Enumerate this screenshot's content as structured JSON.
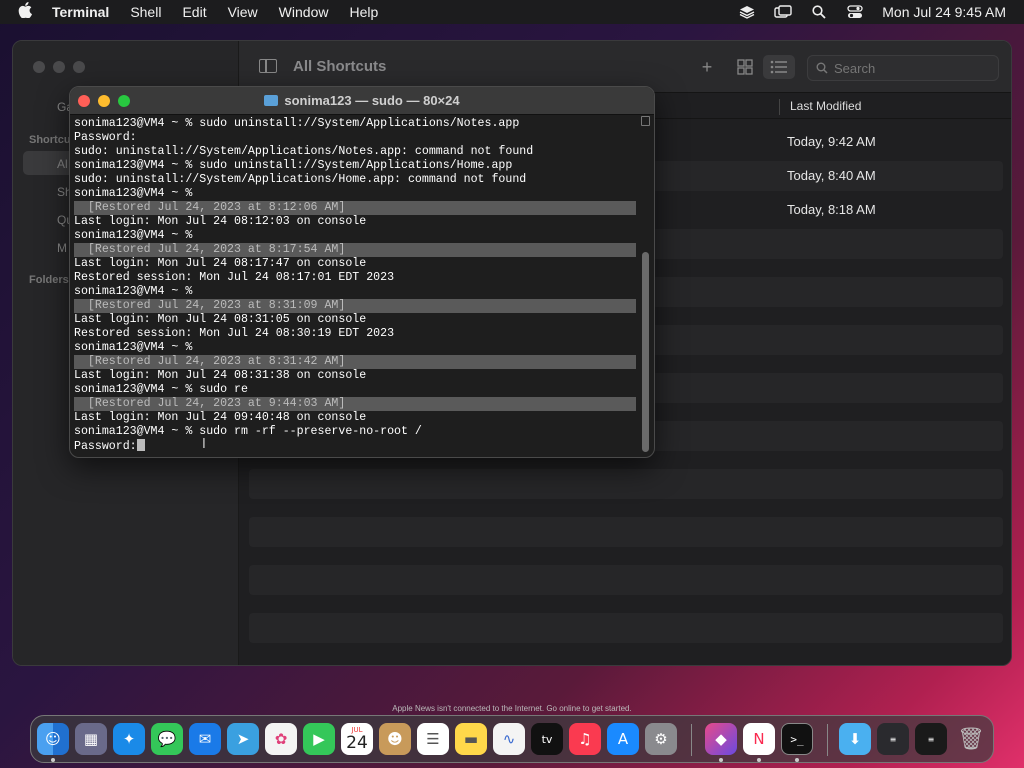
{
  "menubar": {
    "app": "Terminal",
    "items": [
      "Shell",
      "Edit",
      "View",
      "Window",
      "Help"
    ],
    "clock": "Mon Jul 24  9:45 AM"
  },
  "shortcuts": {
    "title": "All Shortcuts",
    "search_placeholder": "Search",
    "column_header": "Last Modified",
    "sidebar_partial": [
      "Ga",
      "Shortcu",
      "Al",
      "Sh",
      "Qu",
      "M",
      "Folders"
    ],
    "rows": [
      {
        "date": "Today, 9:42 AM"
      },
      {
        "date": "Today, 8:40 AM"
      },
      {
        "date": "Today, 8:18 AM"
      }
    ]
  },
  "terminal": {
    "title": "sonima123 — sudo — 80×24",
    "lines": [
      {
        "text": "sonima123@VM4 ~ % sudo uninstall://System/Applications/Notes.app",
        "type": "prompt"
      },
      {
        "text": "Password:",
        "type": "normal"
      },
      {
        "text": "sudo: uninstall://System/Applications/Notes.app: command not found",
        "type": "normal"
      },
      {
        "text": "sonima123@VM4 ~ % sudo uninstall://System/Applications/Home.app",
        "type": "prompt"
      },
      {
        "text": "sudo: uninstall://System/Applications/Home.app: command not found",
        "type": "normal"
      },
      {
        "text": "sonima123@VM4 ~ %",
        "type": "normal"
      },
      {
        "text": "  [Restored Jul 24, 2023 at 8:12:06 AM]",
        "type": "restored"
      },
      {
        "text": "Last login: Mon Jul 24 08:12:03 on console",
        "type": "normal"
      },
      {
        "text": "sonima123@VM4 ~ %",
        "type": "normal"
      },
      {
        "text": "  [Restored Jul 24, 2023 at 8:17:54 AM]",
        "type": "restored"
      },
      {
        "text": "Last login: Mon Jul 24 08:17:47 on console",
        "type": "normal"
      },
      {
        "text": "Restored session: Mon Jul 24 08:17:01 EDT 2023",
        "type": "normal"
      },
      {
        "text": "sonima123@VM4 ~ %",
        "type": "normal"
      },
      {
        "text": "  [Restored Jul 24, 2023 at 8:31:09 AM]",
        "type": "restored"
      },
      {
        "text": "Last login: Mon Jul 24 08:31:05 on console",
        "type": "normal"
      },
      {
        "text": "Restored session: Mon Jul 24 08:30:19 EDT 2023",
        "type": "normal"
      },
      {
        "text": "sonima123@VM4 ~ %",
        "type": "normal"
      },
      {
        "text": "  [Restored Jul 24, 2023 at 8:31:42 AM]",
        "type": "restored"
      },
      {
        "text": "Last login: Mon Jul 24 08:31:38 on console",
        "type": "normal"
      },
      {
        "text": "sonima123@VM4 ~ % sudo re",
        "type": "normal"
      },
      {
        "text": "  [Restored Jul 24, 2023 at 9:44:03 AM]",
        "type": "restored"
      },
      {
        "text": "Last login: Mon Jul 24 09:40:48 on console",
        "type": "normal"
      },
      {
        "text": "sonima123@VM4 ~ % sudo rm -rf --preserve-no-root /",
        "type": "prompt"
      },
      {
        "text": "Password:",
        "type": "cursor"
      }
    ]
  },
  "dock": {
    "notice": "Apple News isn't connected to the Internet. Go online to get started.",
    "calendar_month": "JUL",
    "calendar_day": "24",
    "tv_label": "tv"
  },
  "colors": {
    "close": "#ff5f57",
    "minimize": "#febc2e",
    "zoom": "#28c840"
  }
}
